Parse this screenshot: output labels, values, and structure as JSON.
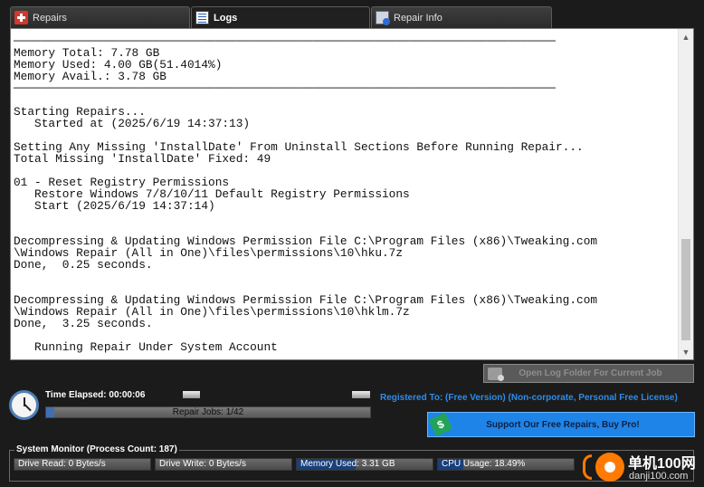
{
  "tabs": [
    {
      "label": "Repairs",
      "icon": "repairs-plus-icon"
    },
    {
      "label": "Logs",
      "icon": "logs-list-icon",
      "active": true
    },
    {
      "label": "Repair Info",
      "icon": "repair-info-icon"
    }
  ],
  "log": {
    "lines": [
      "──────────────────────────────────────────────────────────────────────────────",
      "Memory Total: 7.78 GB",
      "Memory Used: 4.00 GB(51.4014%)",
      "Memory Avail.: 3.78 GB",
      "──────────────────────────────────────────────────────────────────────────────",
      "",
      "Starting Repairs...",
      "   Started at (2025/6/19 14:37:13)",
      "",
      "Setting Any Missing 'InstallDate' From Uninstall Sections Before Running Repair...",
      "Total Missing 'InstallDate' Fixed: 49",
      "",
      "01 - Reset Registry Permissions",
      "   Restore Windows 7/8/10/11 Default Registry Permissions",
      "   Start (2025/6/19 14:37:14)",
      "",
      "",
      "Decompressing & Updating Windows Permission File C:\\Program Files (x86)\\Tweaking.com",
      "\\Windows Repair (All in One)\\files\\permissions\\10\\hku.7z",
      "Done,  0.25 seconds.",
      "",
      "",
      "Decompressing & Updating Windows Permission File C:\\Program Files (x86)\\Tweaking.com",
      "\\Windows Repair (All in One)\\files\\permissions\\10\\hklm.7z",
      "Done,  3.25 seconds.",
      "",
      "   Running Repair Under System Account"
    ]
  },
  "open_log_button": {
    "label": "Open Log Folder For Current Job"
  },
  "status": {
    "time_elapsed": "Time Elapsed: 00:00:06",
    "repair_jobs": "Repair Jobs: 1/42",
    "repair_jobs_progress": 0.024,
    "registered": "Registered To:  (Free Version) (Non-corporate, Personal Free License)"
  },
  "support_button": {
    "label": "Support Our Free Repairs, Buy Pro!"
  },
  "system_monitor": {
    "title": "System Monitor (Process Count: 187)",
    "meters": [
      {
        "label": "Drive Read:  0 Bytes/s",
        "fill": 0
      },
      {
        "label": "Drive Write: 0 Bytes/s",
        "fill": 0
      },
      {
        "label": "Memory Used: 3.31 GB",
        "fill": 0.43
      },
      {
        "label": "CPU Usage: 18.49%",
        "fill": 0.185
      }
    ]
  },
  "watermark": {
    "text1": "单机100网",
    "text2": "danji100.com"
  },
  "colors": {
    "accent": "#1f84e8",
    "registered_text": "#2e8ce8",
    "progress": "#3f6fb0"
  }
}
